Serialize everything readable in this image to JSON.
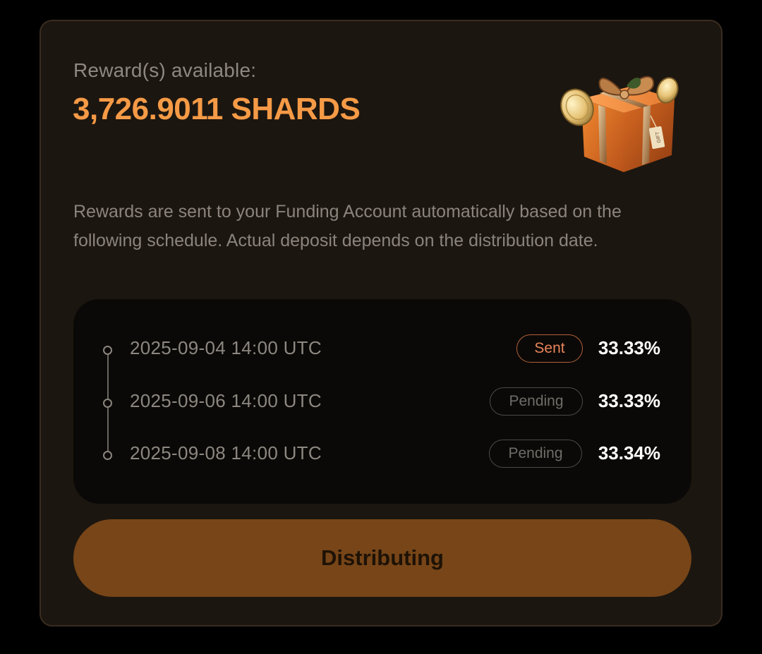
{
  "reward": {
    "label": "Reward(s) available:",
    "amount": "3,726.9011 SHARDS"
  },
  "gift_icon": "gift-box-with-coins-icon",
  "gift_tag_text": "GIFT",
  "description": "Rewards are sent to your Funding Account automatically based on the following schedule. Actual deposit depends on the distribution date.",
  "schedule": [
    {
      "date": "2025-09-04 14:00 UTC",
      "status": "Sent",
      "percent": "33.33%"
    },
    {
      "date": "2025-09-06 14:00 UTC",
      "status": "Pending",
      "percent": "33.33%"
    },
    {
      "date": "2025-09-08 14:00 UTC",
      "status": "Pending",
      "percent": "33.34%"
    }
  ],
  "button": {
    "label": "Distributing"
  },
  "colors": {
    "accent": "#f59a46",
    "card_bg": "#1c1610",
    "button_bg": "#774518",
    "sent_badge": "#e8855a"
  }
}
